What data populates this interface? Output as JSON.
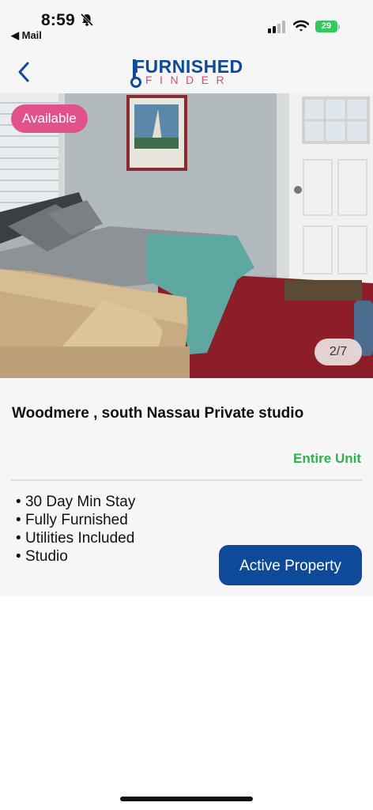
{
  "status_bar": {
    "time": "8:59",
    "back_app": "◀ Mail",
    "battery": "29"
  },
  "header": {
    "logo_top": "FURNISHED",
    "logo_bottom": "FINDER",
    "brand_blue": "#0d4a9a",
    "brand_pink": "#e0457f"
  },
  "listing": {
    "availability_badge": "Available",
    "photo_counter": "2/7",
    "title": "Woodmere , south Nassau Private studio",
    "unit_type": "Entire Unit",
    "features": [
      "30 Day Min Stay",
      "Fully Furnished",
      "Utilities Included",
      "Studio"
    ],
    "action_label": "Active Property"
  }
}
